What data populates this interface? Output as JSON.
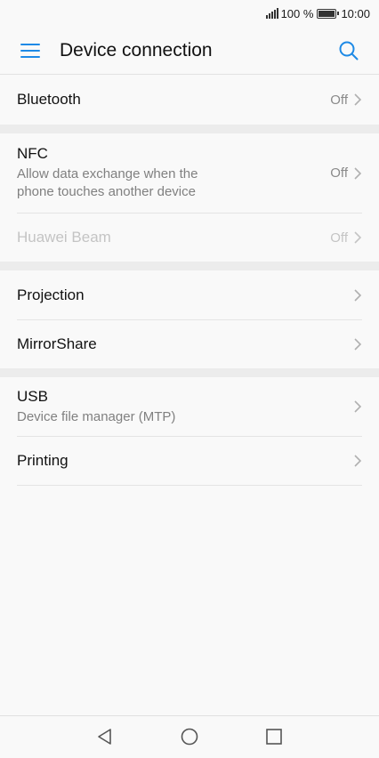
{
  "status_bar": {
    "battery_text": "100 %",
    "time": "10:00"
  },
  "header": {
    "title": "Device connection"
  },
  "rows": {
    "bluetooth": {
      "title": "Bluetooth",
      "value": "Off"
    },
    "nfc": {
      "title": "NFC",
      "subtitle": "Allow data exchange when the phone touches another device",
      "value": "Off"
    },
    "huawei_beam": {
      "title": "Huawei Beam",
      "value": "Off"
    },
    "projection": {
      "title": "Projection"
    },
    "mirrorshare": {
      "title": "MirrorShare"
    },
    "usb": {
      "title": "USB",
      "subtitle": "Device file manager (MTP)"
    },
    "printing": {
      "title": "Printing"
    }
  },
  "colors": {
    "accent": "#1e8ae6",
    "disabled_text": "#c4c4c4",
    "secondary_text": "#808080"
  },
  "icons": [
    "menu-icon",
    "search-icon",
    "chevron-right-icon",
    "back-icon",
    "home-icon",
    "recents-icon",
    "signal-icon",
    "battery-icon"
  ]
}
